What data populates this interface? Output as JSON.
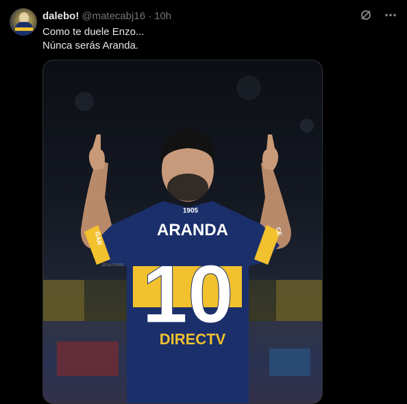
{
  "tweet": {
    "display_name": "dalebo!",
    "handle": "@matecabj16",
    "separator": "·",
    "time": "10h",
    "text_line1": "Como te duele Enzo...",
    "text_line2": "Núnca serás Aranda."
  },
  "media": {
    "jersey_name": "ARANDA",
    "jersey_number": "10",
    "jersey_year": "1905",
    "sponsor": "DIRECTV",
    "sleeve_left": "GAR",
    "sleeve_right": "CE",
    "watermark": "@lautrada"
  },
  "icons": {
    "grok": "grok-icon",
    "more": "more-icon"
  },
  "colors": {
    "background": "#000000",
    "text": "#e7e9ea",
    "muted": "#71767b",
    "boca_blue": "#1b2f6b",
    "boca_gold": "#f2c12e"
  }
}
